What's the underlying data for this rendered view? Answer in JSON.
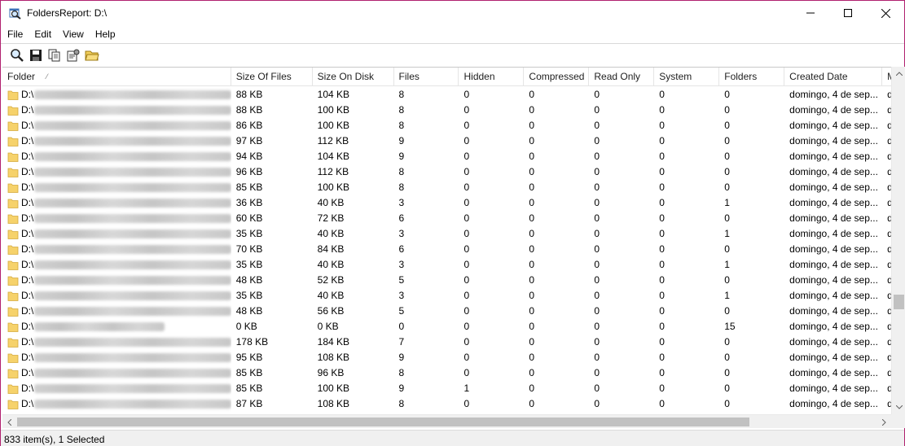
{
  "window": {
    "title": "FoldersReport: D:\\",
    "controls": {
      "minimize": "minimize",
      "maximize": "maximize",
      "close": "close"
    }
  },
  "menu": [
    "File",
    "Edit",
    "View",
    "Help"
  ],
  "toolbar": {
    "buttons": [
      "search-icon",
      "save-icon",
      "copy-icon",
      "properties-icon",
      "open-folder-icon"
    ]
  },
  "list": {
    "columns": [
      "Folder",
      "Size Of Files",
      "Size On Disk",
      "Files",
      "Hidden",
      "Compressed",
      "Read Only",
      "System",
      "Folders",
      "Created Date",
      "M"
    ],
    "rows": [
      {
        "folder": "D:\\",
        "size": "88 KB",
        "disk": "104 KB",
        "files": "8",
        "hidden": "0",
        "compressed": "0",
        "readonly": "0",
        "system": "0",
        "folders": "0",
        "created": "domingo, 4 de sep...",
        "more": "d"
      },
      {
        "folder": "D:\\",
        "size": "88 KB",
        "disk": "100 KB",
        "files": "8",
        "hidden": "0",
        "compressed": "0",
        "readonly": "0",
        "system": "0",
        "folders": "0",
        "created": "domingo, 4 de sep...",
        "more": "d"
      },
      {
        "folder": "D:\\",
        "size": "86 KB",
        "disk": "100 KB",
        "files": "8",
        "hidden": "0",
        "compressed": "0",
        "readonly": "0",
        "system": "0",
        "folders": "0",
        "created": "domingo, 4 de sep...",
        "more": "d"
      },
      {
        "folder": "D:\\",
        "size": "97 KB",
        "disk": "112 KB",
        "files": "9",
        "hidden": "0",
        "compressed": "0",
        "readonly": "0",
        "system": "0",
        "folders": "0",
        "created": "domingo, 4 de sep...",
        "more": "d"
      },
      {
        "folder": "D:\\",
        "size": "94 KB",
        "disk": "104 KB",
        "files": "9",
        "hidden": "0",
        "compressed": "0",
        "readonly": "0",
        "system": "0",
        "folders": "0",
        "created": "domingo, 4 de sep...",
        "more": "d"
      },
      {
        "folder": "D:\\",
        "size": "96 KB",
        "disk": "112 KB",
        "files": "8",
        "hidden": "0",
        "compressed": "0",
        "readonly": "0",
        "system": "0",
        "folders": "0",
        "created": "domingo, 4 de sep...",
        "more": "d"
      },
      {
        "folder": "D:\\",
        "size": "85 KB",
        "disk": "100 KB",
        "files": "8",
        "hidden": "0",
        "compressed": "0",
        "readonly": "0",
        "system": "0",
        "folders": "0",
        "created": "domingo, 4 de sep...",
        "more": "d"
      },
      {
        "folder": "D:\\",
        "size": "36 KB",
        "disk": "40 KB",
        "files": "3",
        "hidden": "0",
        "compressed": "0",
        "readonly": "0",
        "system": "0",
        "folders": "1",
        "created": "domingo, 4 de sep...",
        "more": "d"
      },
      {
        "folder": "D:\\",
        "size": "60 KB",
        "disk": "72 KB",
        "files": "6",
        "hidden": "0",
        "compressed": "0",
        "readonly": "0",
        "system": "0",
        "folders": "0",
        "created": "domingo, 4 de sep...",
        "more": "d"
      },
      {
        "folder": "D:\\",
        "size": "35 KB",
        "disk": "40 KB",
        "files": "3",
        "hidden": "0",
        "compressed": "0",
        "readonly": "0",
        "system": "0",
        "folders": "1",
        "created": "domingo, 4 de sep...",
        "more": "d"
      },
      {
        "folder": "D:\\",
        "size": "70 KB",
        "disk": "84 KB",
        "files": "6",
        "hidden": "0",
        "compressed": "0",
        "readonly": "0",
        "system": "0",
        "folders": "0",
        "created": "domingo, 4 de sep...",
        "more": "d"
      },
      {
        "folder": "D:\\",
        "size": "35 KB",
        "disk": "40 KB",
        "files": "3",
        "hidden": "0",
        "compressed": "0",
        "readonly": "0",
        "system": "0",
        "folders": "1",
        "created": "domingo, 4 de sep...",
        "more": "d"
      },
      {
        "folder": "D:\\",
        "size": "48 KB",
        "disk": "52 KB",
        "files": "5",
        "hidden": "0",
        "compressed": "0",
        "readonly": "0",
        "system": "0",
        "folders": "0",
        "created": "domingo, 4 de sep...",
        "more": "d"
      },
      {
        "folder": "D:\\",
        "size": "35 KB",
        "disk": "40 KB",
        "files": "3",
        "hidden": "0",
        "compressed": "0",
        "readonly": "0",
        "system": "0",
        "folders": "1",
        "created": "domingo, 4 de sep...",
        "more": "d"
      },
      {
        "folder": "D:\\",
        "size": "48 KB",
        "disk": "56 KB",
        "files": "5",
        "hidden": "0",
        "compressed": "0",
        "readonly": "0",
        "system": "0",
        "folders": "0",
        "created": "domingo, 4 de sep...",
        "more": "d"
      },
      {
        "folder": "D:\\",
        "size": "0 KB",
        "disk": "0 KB",
        "files": "0",
        "hidden": "0",
        "compressed": "0",
        "readonly": "0",
        "system": "0",
        "folders": "15",
        "created": "domingo, 4 de sep...",
        "more": "d"
      },
      {
        "folder": "D:\\",
        "size": "178 KB",
        "disk": "184 KB",
        "files": "7",
        "hidden": "0",
        "compressed": "0",
        "readonly": "0",
        "system": "0",
        "folders": "0",
        "created": "domingo, 4 de sep...",
        "more": "d"
      },
      {
        "folder": "D:\\",
        "size": "95 KB",
        "disk": "108 KB",
        "files": "9",
        "hidden": "0",
        "compressed": "0",
        "readonly": "0",
        "system": "0",
        "folders": "0",
        "created": "domingo, 4 de sep...",
        "more": "d"
      },
      {
        "folder": "D:\\",
        "size": "85 KB",
        "disk": "96 KB",
        "files": "8",
        "hidden": "0",
        "compressed": "0",
        "readonly": "0",
        "system": "0",
        "folders": "0",
        "created": "domingo, 4 de sep...",
        "more": "d"
      },
      {
        "folder": "D:\\",
        "size": "85 KB",
        "disk": "100 KB",
        "files": "9",
        "hidden": "1",
        "compressed": "0",
        "readonly": "0",
        "system": "0",
        "folders": "0",
        "created": "domingo, 4 de sep...",
        "more": "d"
      },
      {
        "folder": "D:\\",
        "size": "87 KB",
        "disk": "108 KB",
        "files": "8",
        "hidden": "0",
        "compressed": "0",
        "readonly": "0",
        "system": "0",
        "folders": "0",
        "created": "domingo, 4 de sep...",
        "more": "d"
      }
    ]
  },
  "status": {
    "text": "833 item(s), 1 Selected"
  },
  "colors": {
    "window_border": "#b0216f",
    "folder_icon": "#f6d26b",
    "scrollbar_thumb": "#c1c1c1"
  }
}
